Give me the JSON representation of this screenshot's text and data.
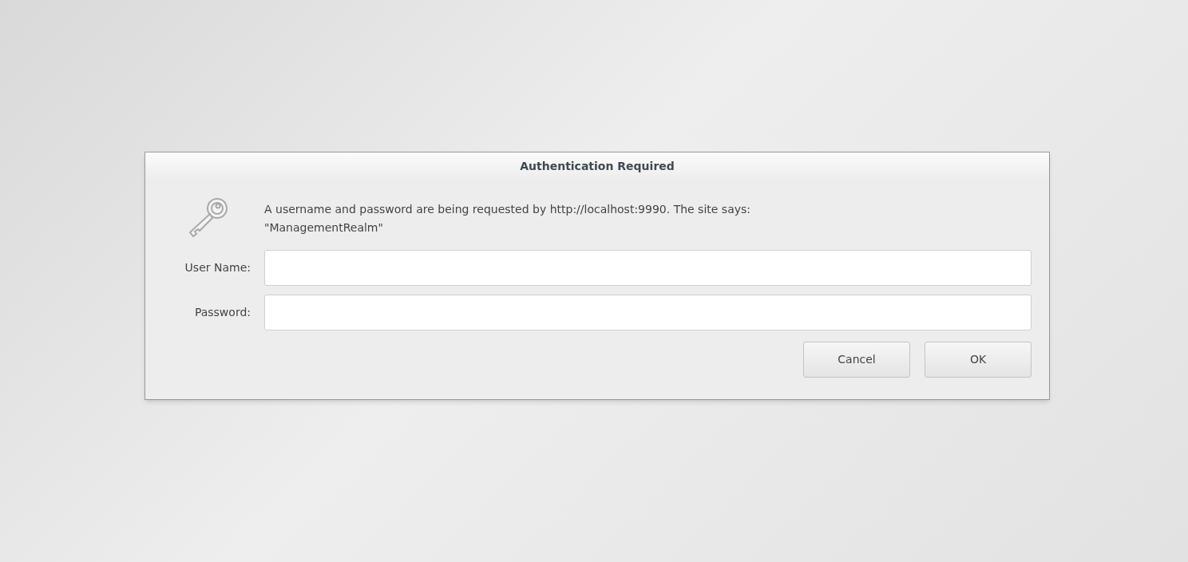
{
  "dialog": {
    "title": "Authentication Required",
    "message": [
      "A username and password are being requested by http://localhost:9990. The site says:",
      "\"ManagementRealm\""
    ],
    "fields": [
      {
        "label": "User Name:"
      },
      {
        "label": "Password:"
      }
    ],
    "buttons": [
      "Cancel",
      "OK"
    ]
  }
}
